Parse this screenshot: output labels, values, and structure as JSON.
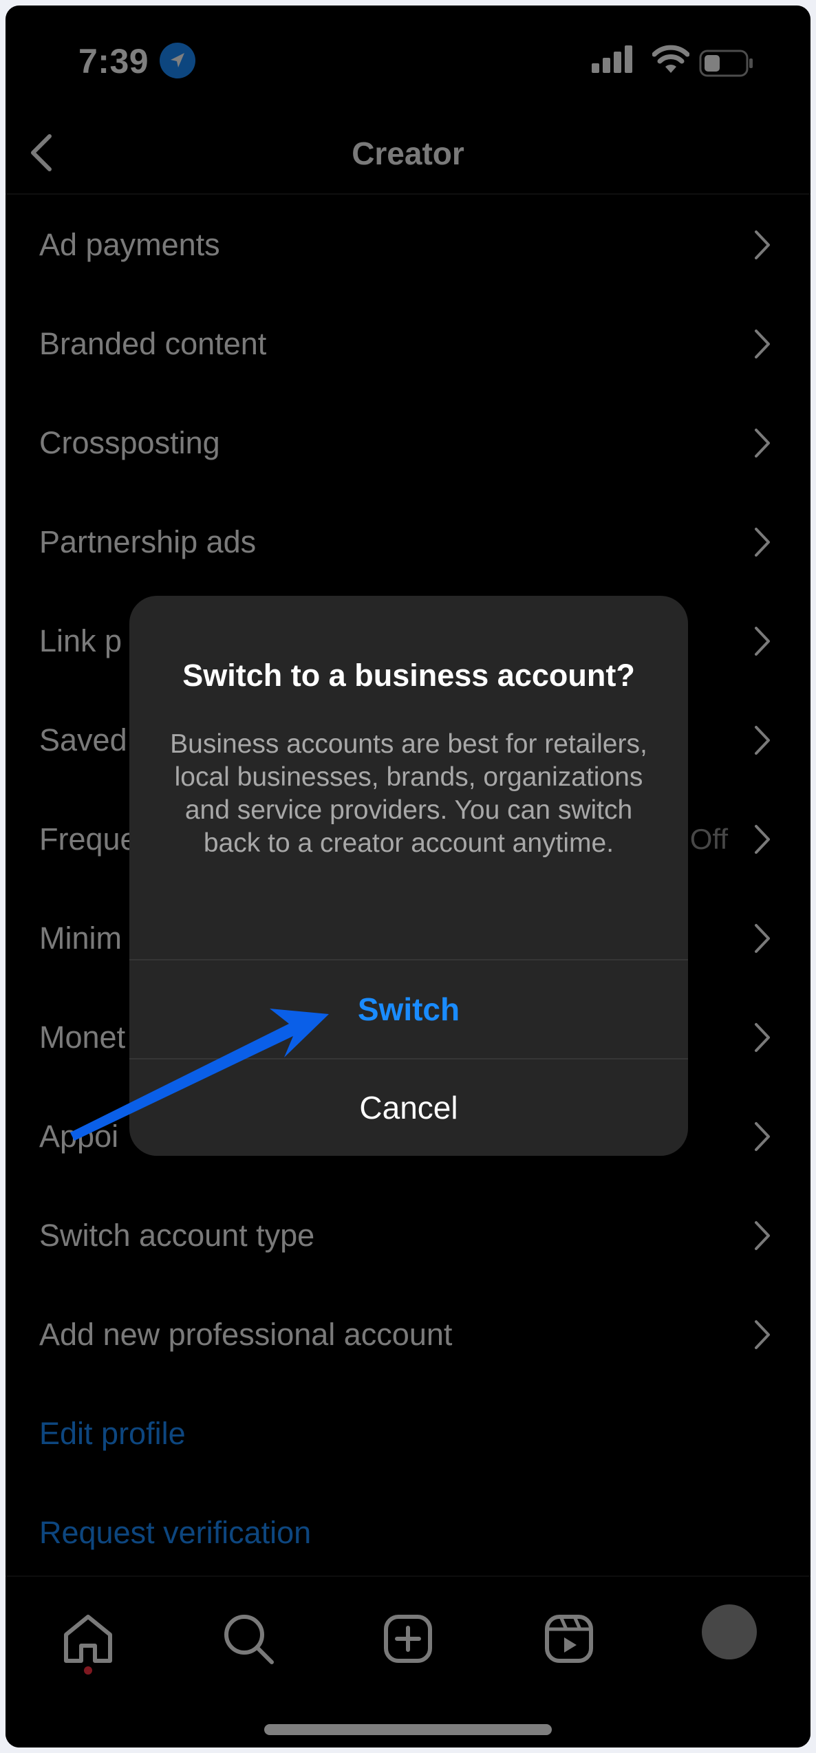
{
  "status_bar": {
    "time": "7:39"
  },
  "header": {
    "title": "Creator"
  },
  "menu_items": [
    {
      "label": "Ad payments",
      "value": ""
    },
    {
      "label": "Branded content",
      "value": ""
    },
    {
      "label": "Crossposting",
      "value": ""
    },
    {
      "label": "Partnership ads",
      "value": ""
    },
    {
      "label": "Link p",
      "value": ""
    },
    {
      "label": "Saved",
      "value": ""
    },
    {
      "label": "Freque",
      "value": "Off"
    },
    {
      "label": "Minim",
      "value": ""
    },
    {
      "label": "Monet",
      "value": ""
    },
    {
      "label": "Appoi",
      "value": ""
    },
    {
      "label": "Switch account type",
      "value": ""
    },
    {
      "label": "Add new professional account",
      "value": ""
    }
  ],
  "links": [
    {
      "label": "Edit profile"
    },
    {
      "label": "Request verification"
    }
  ],
  "dialog": {
    "title": "Switch to a business account?",
    "body": "Business accounts are best for retailers, local businesses, brands, organizations and service providers. You can switch back to a creator account anytime.",
    "primary_button": "Switch",
    "secondary_button": "Cancel"
  },
  "colors": {
    "accent": "#1a8cff",
    "background": "#000000",
    "dialog": "#262626",
    "annotation_arrow": "#0a5fe8"
  },
  "icons": {
    "back": "chevron-left-icon",
    "tabs": [
      "home-icon",
      "search-icon",
      "create-icon",
      "reels-icon",
      "profile-avatar"
    ]
  }
}
